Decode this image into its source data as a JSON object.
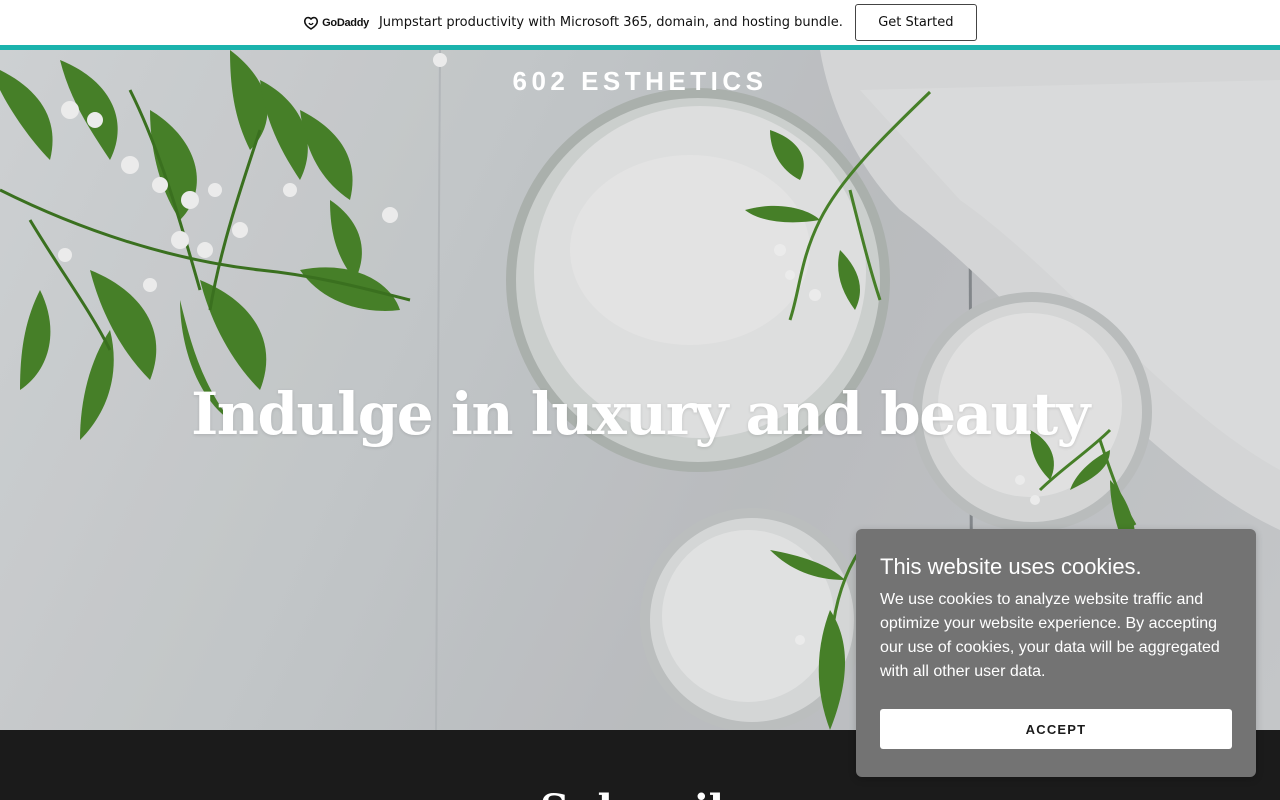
{
  "promo": {
    "logo_text": "GoDaddy",
    "message": "Jumpstart productivity with Microsoft 365, domain, and hosting bundle.",
    "cta_label": "Get Started",
    "accent_color": "#1bb3ad"
  },
  "hero": {
    "brand": "602 ESTHETICS",
    "headline": "Indulge in luxury and beauty"
  },
  "next_section": {
    "heading": "Subscribe"
  },
  "cookie": {
    "title": "This website uses cookies.",
    "body": "We use cookies to analyze website traffic and optimize your website experience. By accepting our use of cookies, your data will be aggregated with all other user data.",
    "accept_label": "ACCEPT"
  }
}
